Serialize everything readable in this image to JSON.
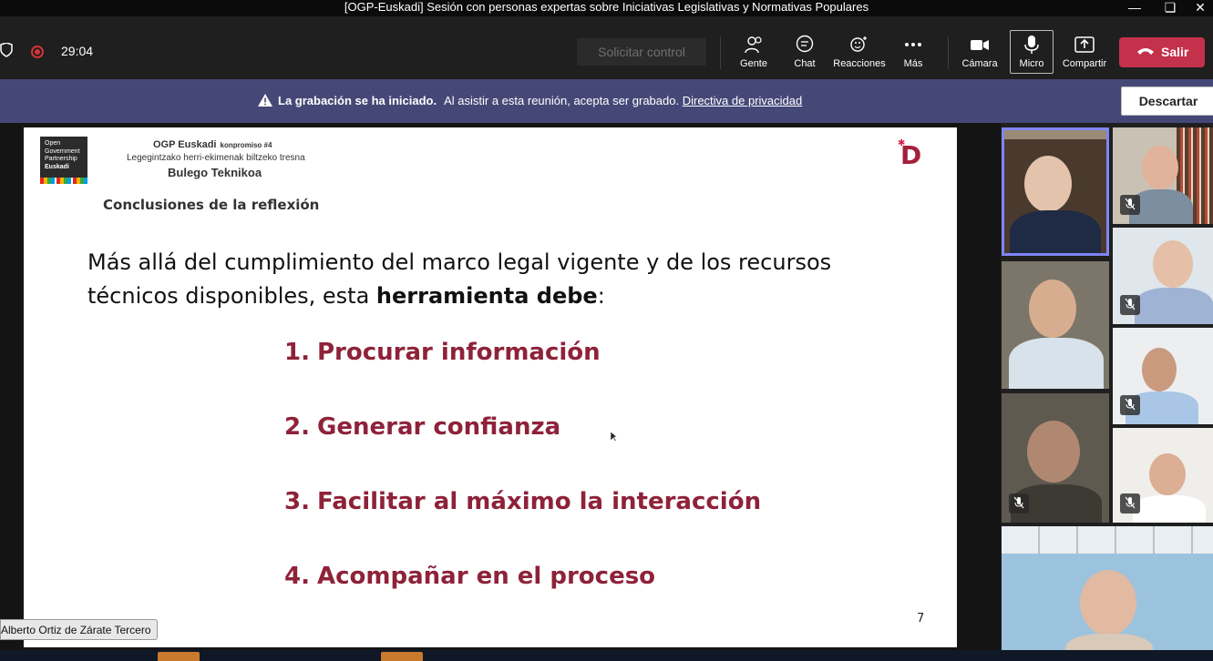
{
  "window": {
    "title": "[OGP-Euskadi] Sesión con personas expertas sobre Iniciativas Legislativas y Normativas Populares"
  },
  "meeting": {
    "timer": "29:04",
    "request_control": "Solicitar control",
    "controls": {
      "people": "Gente",
      "chat": "Chat",
      "reactions": "Reacciones",
      "more": "Más",
      "camera": "Cámara",
      "mic": "Micro",
      "share": "Compartir",
      "leave": "Salir"
    }
  },
  "banner": {
    "bold": "La grabación se ha iniciado.",
    "text": "Al asistir a esta reunión, acepta ser grabado.",
    "link": "Directiva de privacidad",
    "dismiss": "Descartar"
  },
  "slide": {
    "logo_lines": [
      "Open",
      "Government",
      "Partnership",
      "Euskadi"
    ],
    "header_title": "OGP Euskadi",
    "header_small": "konpromiso #4",
    "header_sub": "Legegintzako herri-ekimenak biltzeko tresna",
    "header_office": "Bulego Teknikoa",
    "brand_letter": "D",
    "section": "Conclusiones de la reflexión",
    "lead_start": "Más allá del cumplimiento del marco legal vigente y de los recursos técnicos disponibles, esta ",
    "lead_bold": "herramienta debe",
    "lead_end": ":",
    "items": [
      {
        "num": "1.",
        "text": "Procurar información"
      },
      {
        "num": "2.",
        "text": "Generar confianza"
      },
      {
        "num": "3.",
        "text": "Facilitar al máximo la interacción"
      },
      {
        "num": "4.",
        "text": "Acompañar en el proceso"
      }
    ],
    "page": "7"
  },
  "presenter_name": "Alberto Ortiz de Zárate Tercero",
  "colors": {
    "banner": "#454877",
    "leave": "#c4314b",
    "slide_accent": "#8e2239",
    "active_speaker": "#7f85f5"
  }
}
